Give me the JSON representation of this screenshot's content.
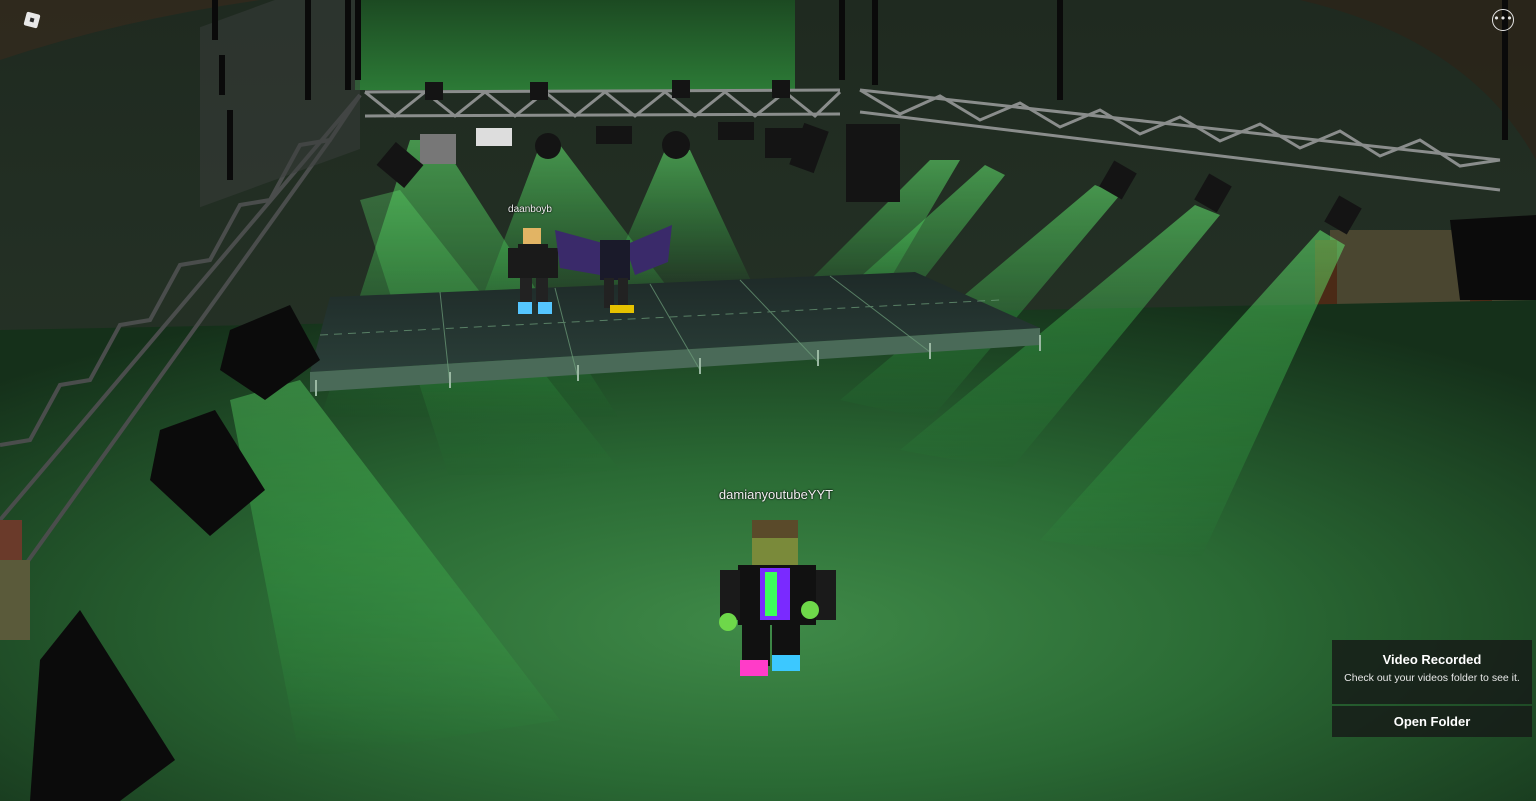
{
  "topbar": {
    "menu_icon": "roblox-logo-icon",
    "more_icon": "more-options-icon",
    "more_glyph": "•••"
  },
  "players": {
    "stage_player": "daanboyb",
    "local_player": "damianyoutubeYYT"
  },
  "notification": {
    "title": "Video Recorded",
    "message": "Check out your videos folder to see it.",
    "button_label": "Open Folder"
  },
  "colors": {
    "light_green": "#3cff5a",
    "floor": "#1f5a2a",
    "truss": "#8a8d8c",
    "toast_bg": "#161a17"
  }
}
